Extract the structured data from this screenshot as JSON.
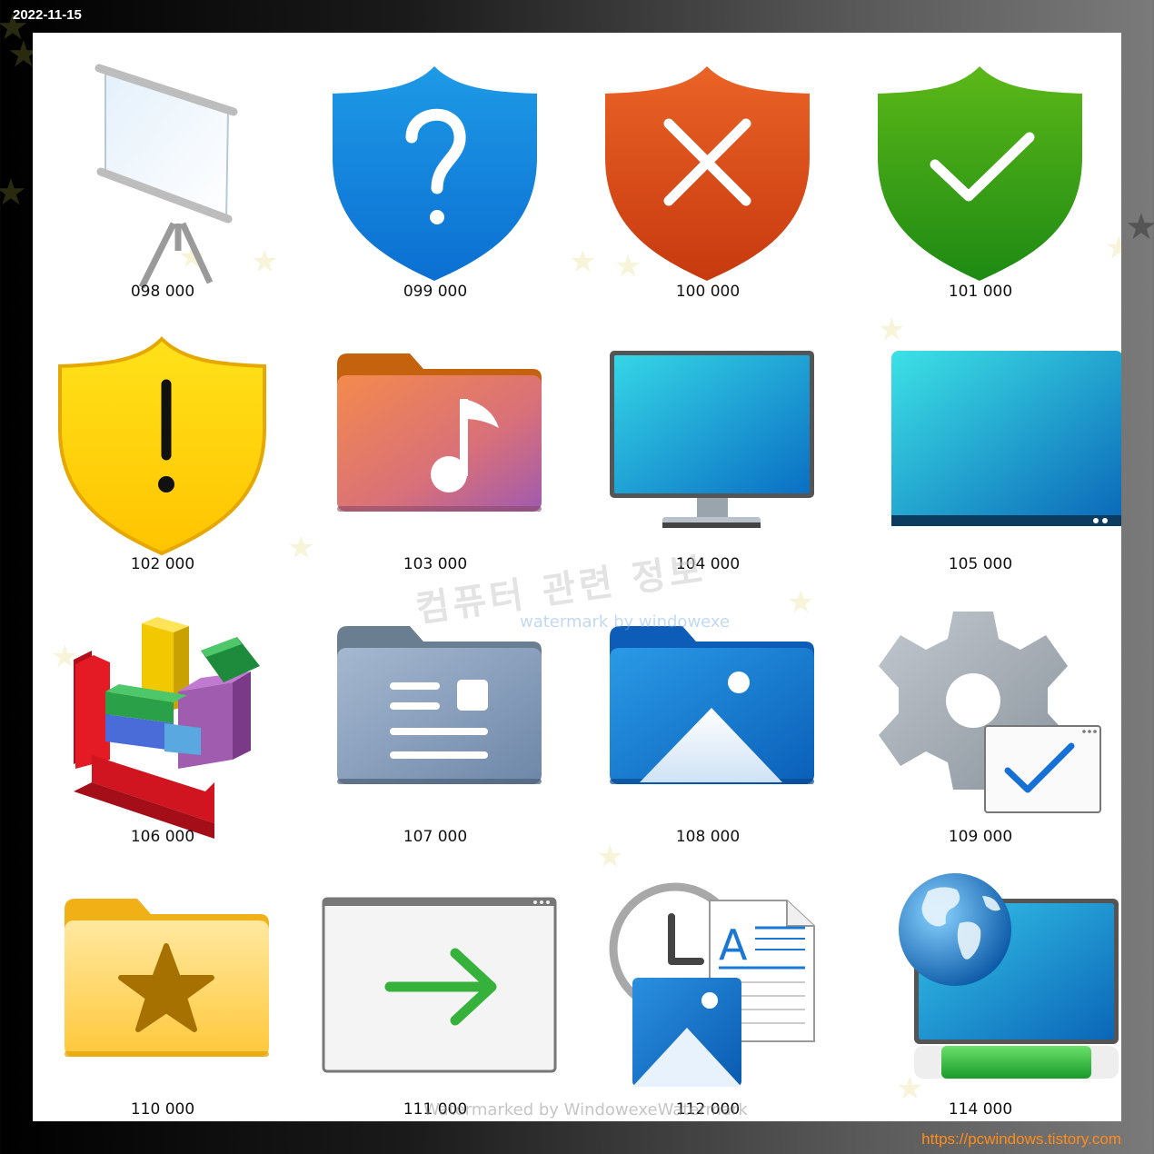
{
  "date": "2022-11-15",
  "site_url": "https://pcwindows.tistory.com",
  "watermark": {
    "korean_title": "컴퓨터 관련 정보",
    "subtitle": "watermark by windowexe",
    "footer": "Watermarked by WindowexeWatermark"
  },
  "icons": [
    {
      "label": "098 000",
      "icon": "projector-screen-icon"
    },
    {
      "label": "099 000",
      "icon": "shield-question-icon"
    },
    {
      "label": "100 000",
      "icon": "shield-error-icon"
    },
    {
      "label": "101 000",
      "icon": "shield-check-icon"
    },
    {
      "label": "102 000",
      "icon": "shield-warning-icon"
    },
    {
      "label": "103 000",
      "icon": "music-folder-icon"
    },
    {
      "label": "104 000",
      "icon": "monitor-icon"
    },
    {
      "label": "105 000",
      "icon": "desktop-icon"
    },
    {
      "label": "106 000",
      "icon": "defragment-blocks-icon"
    },
    {
      "label": "107 000",
      "icon": "documents-folder-icon"
    },
    {
      "label": "108 000",
      "icon": "pictures-folder-icon"
    },
    {
      "label": "109 000",
      "icon": "settings-check-icon"
    },
    {
      "label": "110 000",
      "icon": "favorites-folder-icon"
    },
    {
      "label": "111 000",
      "icon": "window-arrow-icon"
    },
    {
      "label": "112 000",
      "icon": "recent-files-icon"
    },
    {
      "label": "114 000",
      "icon": "network-globe-icon"
    }
  ],
  "colors": {
    "shield_blue": "#1b8fe0",
    "shield_red": "#e0531c",
    "shield_green": "#3aa318",
    "shield_yellow": "#ffd200",
    "site_url": "#ff8c1a"
  }
}
